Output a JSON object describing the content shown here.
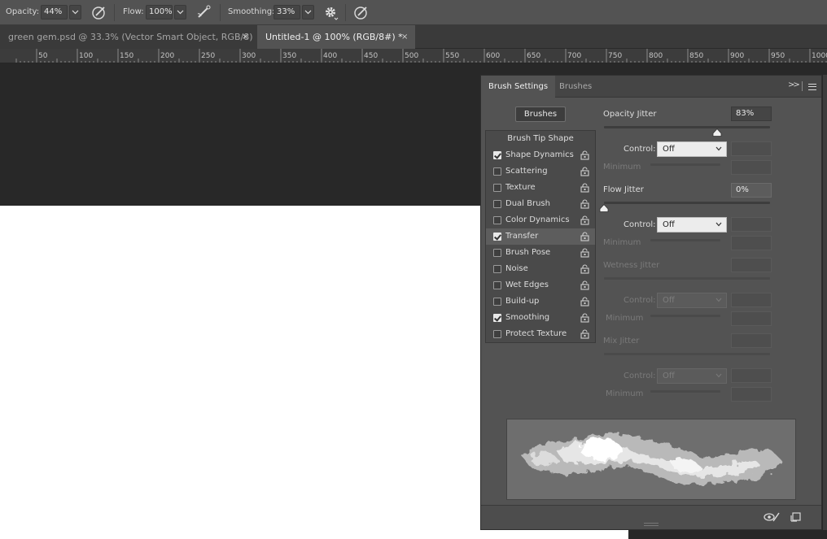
{
  "options_bar": {
    "opacity_label": "Opacity:",
    "opacity_value": "44%",
    "flow_label": "Flow:",
    "flow_value": "100%",
    "smoothing_label": "Smoothing:",
    "smoothing_value": "33%",
    "icons": [
      "airbrush-pressure-icon",
      "airbrush-icon",
      "gear-icon",
      "size-pressure-icon"
    ]
  },
  "doc_tabs": [
    {
      "label": "green gem.psd @ 33.3% (Vector Smart Object, RGB/8)",
      "close": "×",
      "active": false
    },
    {
      "label": "Untitled-1 @ 100% (RGB/8#) *",
      "close": "×",
      "active": true
    }
  ],
  "ruler": {
    "start": 25,
    "end": 1000,
    "step": 50,
    "labels": [
      "50",
      "100",
      "150",
      "200",
      "250",
      "300",
      "350",
      "400",
      "450",
      "500",
      "550",
      "600",
      "650",
      "700",
      "750",
      "800",
      "850",
      "900",
      "950",
      "1000"
    ]
  },
  "panel": {
    "tabs": [
      {
        "label": "Brush Settings",
        "active": true
      },
      {
        "label": "Brushes",
        "active": false
      }
    ],
    "brushes_button": "Brushes",
    "tip_list": {
      "header": "Brush Tip Shape",
      "items": [
        {
          "label": "Shape Dynamics",
          "checked": true,
          "selected": false
        },
        {
          "label": "Scattering",
          "checked": false,
          "selected": false
        },
        {
          "label": "Texture",
          "checked": false,
          "selected": false
        },
        {
          "label": "Dual Brush",
          "checked": false,
          "selected": false
        },
        {
          "label": "Color Dynamics",
          "checked": false,
          "selected": false
        },
        {
          "label": "Transfer",
          "checked": true,
          "selected": true
        },
        {
          "label": "Brush Pose",
          "checked": false,
          "selected": false
        },
        {
          "label": "Noise",
          "checked": false,
          "selected": false
        },
        {
          "label": "Wet Edges",
          "checked": false,
          "selected": false
        },
        {
          "label": "Build-up",
          "checked": false,
          "selected": false
        },
        {
          "label": "Smoothing",
          "checked": true,
          "selected": false
        },
        {
          "label": "Protect Texture",
          "checked": false,
          "selected": false
        }
      ]
    },
    "opacity_jitter": {
      "label": "Opacity Jitter",
      "value": "83%",
      "fraction": 0.83,
      "control_label": "Control:",
      "control_value": "Off",
      "minimum_label": "Minimum"
    },
    "flow_jitter": {
      "label": "Flow Jitter",
      "value": "0%",
      "fraction": 0.0,
      "control_label": "Control:",
      "control_value": "Off",
      "minimum_label": "Minimum"
    },
    "wetness_jitter": {
      "label": "Wetness Jitter",
      "control_label": "Control:",
      "control_value": "Off",
      "minimum_label": "Minimum"
    },
    "mix_jitter": {
      "label": "Mix Jitter",
      "control_label": "Control:",
      "control_value": "Off",
      "minimum_label": "Minimum"
    }
  },
  "colors": {
    "panel_bg": "#535353",
    "canvas": "#ffffff",
    "workspace": "#282828"
  }
}
